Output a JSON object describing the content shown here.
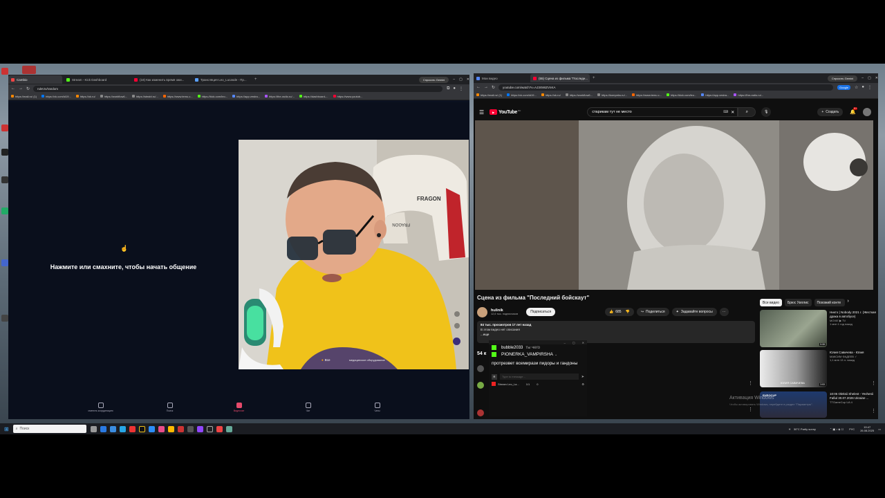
{
  "left_browser": {
    "tabs": [
      {
        "label": "Cambio",
        "active": true
      },
      {
        "label": "Stream - Kick Dashboard"
      },
      {
        "label": "(18) Как изменить время ожи..."
      },
      {
        "label": "Трансляция Leo_Lucasde - Пр..."
      }
    ],
    "gemini_button": "Спросить Gemini",
    "url": "rulet.tv/random",
    "bookmarks": [
      "https://mail.ru/ (1)",
      "https://vk.com/id19...",
      "https://ok.ru/",
      "https://workflow6...",
      "https://steabl.ru/...",
      "https://www.temu.c...",
      "https://kick.com/leo...",
      "https://app.vestra...",
      "https://the-radio.ru/...",
      "https://dashboard-...",
      "https://www.youtub..."
    ]
  },
  "left_app": {
    "prompt": "Нажмите или смахните, чтобы начать общение",
    "chair_brand": "FRAGON",
    "webcam_toggle": "Все",
    "webcam_caption": "медицинское оборудование",
    "bottom_nav": [
      {
        "label": "сменить координацию"
      },
      {
        "label": "Поиск"
      },
      {
        "label": "Видеочат"
      },
      {
        "label": "Чат"
      },
      {
        "label": "Чаты"
      }
    ]
  },
  "right_browser": {
    "tabs": [
      {
        "label": "Мои видео"
      },
      {
        "label": "(55) Сцена из фильма \"Последн...",
        "active": true
      }
    ],
    "gemini_button": "Спросить Gemini",
    "url": "youtube.com/watch?v=AJ3r5WZVnKA",
    "google_badge": "Google",
    "bookmarks": [
      "https://mail.ru/ (1)",
      "https://vk.com/id19...",
      "https://ok.ru/",
      "https://workflow6...",
      "https://kompeks.ru/...",
      "https://www.temu.c...",
      "https://kick.com/leo...",
      "https://app.vestra...",
      "https://the-radio.ru/..."
    ]
  },
  "youtube": {
    "logo": "YouTube",
    "logo_badge": "RU",
    "search_value": "старикам тут не место",
    "create_label": "Создать",
    "notif_count": "9+",
    "video_title": "Сцена из фильма \"Последний бойскаут\"",
    "channel": "hulinik",
    "subscribers": "12,6 тыс. подписчиков",
    "subscribe": "Подписаться",
    "likes": "685",
    "share": "Поделиться",
    "ask": "Задавайте вопросы",
    "views_line": "84 тыс. просмотров  17 лет назад",
    "desc_line": "В этом видео нет описания",
    "more": "...еще",
    "comments_count": "54 к",
    "chips": [
      "Все видео",
      "Брюс Уиллис",
      "Похожий конте"
    ],
    "recommendations": [
      {
        "title": "Никто | Nobody 2021 г. (Жесткая драка в автобусе)",
        "channel": "MOVIE ▶ TV",
        "meta": "1 млн  1 год назад",
        "duration": "5:08"
      },
      {
        "title": "Юлия Савичева - Юлия",
        "channel": "МАКСИМ ФАДЕЕВ ✓",
        "meta": "1,1 млн  13 л. назад",
        "duration": "3:53",
        "overlay": "ЮЛИЯ САВИЧЕВА"
      },
      {
        "title": "10:05 Oleksii Shelest - Yevhenii Fafiul 30.07.2026 Ukraine ...",
        "channel": "TTGameCup UA 4",
        "meta": "",
        "overlay": "EUROCUP"
      }
    ],
    "activation_title": "Активация Windows",
    "activation_sub": "Чтобы активировать Windows, перейдите в раздел \"Параметры\"."
  },
  "chat": {
    "messages": [
      {
        "user": "bubble2033",
        "text": "ты чего"
      },
      {
        "user": "PIONERKA_VAMPIRSHA",
        "text": "протрезвет всемирази пидоры и гандоны"
      }
    ],
    "input_placeholder": "Type to message...",
    "stream_label": "Stream Leo_La...",
    "count": "1/1",
    "zero": "0"
  },
  "taskbar": {
    "search_placeholder": "Поиск",
    "weather": "30°C  Partly sunny",
    "lang": "РУС",
    "time": "19:47",
    "date": "26.08.2025"
  },
  "colors": {
    "youtube_red": "#ff0033",
    "kick_green": "#53fc18",
    "left_bg": "#0a0f1c",
    "shirt_yellow": "#f0c21a",
    "chair_red": "#c0242b"
  }
}
